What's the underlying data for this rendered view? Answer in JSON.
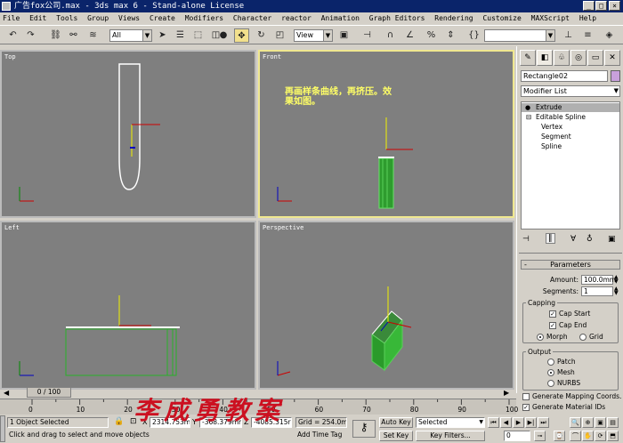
{
  "window": {
    "title": "广告fox公司.max - 3ds max 6 - Stand-alone License"
  },
  "menu": [
    "File",
    "Edit",
    "Tools",
    "Group",
    "Views",
    "Create",
    "Modifiers",
    "Character",
    "reactor",
    "Animation",
    "Graph Editors",
    "Rendering",
    "Customize",
    "MAXScript",
    "Help"
  ],
  "toolbar": {
    "selection_filter": "All",
    "ref_coord": "View",
    "named_selection": ""
  },
  "viewports": {
    "top": {
      "label": "Top"
    },
    "front": {
      "label": "Front",
      "annotation": "再画样条曲线，再挤压。效果如图。"
    },
    "left": {
      "label": "Left"
    },
    "perspective": {
      "label": "Perspective"
    }
  },
  "command_panel": {
    "object_name": "Rectangle02",
    "object_color": "#c8a0dc",
    "modifier_list": "Modifier List",
    "stack": [
      "Extrude",
      "Editable Spline",
      "Vertex",
      "Segment",
      "Spline"
    ],
    "rollout_title": "Parameters",
    "amount_label": "Amount:",
    "amount_value": "100.0mm",
    "segments_label": "Segments:",
    "segments_value": "1",
    "capping_label": "Capping",
    "cap_start": "Cap Start",
    "cap_end": "Cap End",
    "morph": "Morph",
    "grid": "Grid",
    "output_label": "Output",
    "patch": "Patch",
    "mesh": "Mesh",
    "nurbs": "NURBS",
    "gen_mapping": "Generate Mapping Coords.",
    "gen_matids": "Generate Material IDs"
  },
  "timeline": {
    "frame": "0 / 100",
    "ticks": [
      "0",
      "10",
      "20",
      "30",
      "40",
      "50",
      "60",
      "70",
      "80",
      "90",
      "100"
    ]
  },
  "status": {
    "selected": "1 Object Selected",
    "prompt": "Click and drag to select and move objects",
    "x_label": "X",
    "x_value": "2314.753m",
    "y_label": "Y",
    "y_value": "-368.379mm",
    "z_label": "Z",
    "z_value": "-4085.315r",
    "grid": "Grid = 254.0mm",
    "add_time_tag": "Add Time Tag",
    "auto_key": "Auto Key",
    "set_key": "Set Key",
    "key_mode": "Selected",
    "key_filters": "Key Filters...",
    "frame_field": "0"
  },
  "watermark": "李成勇教案"
}
